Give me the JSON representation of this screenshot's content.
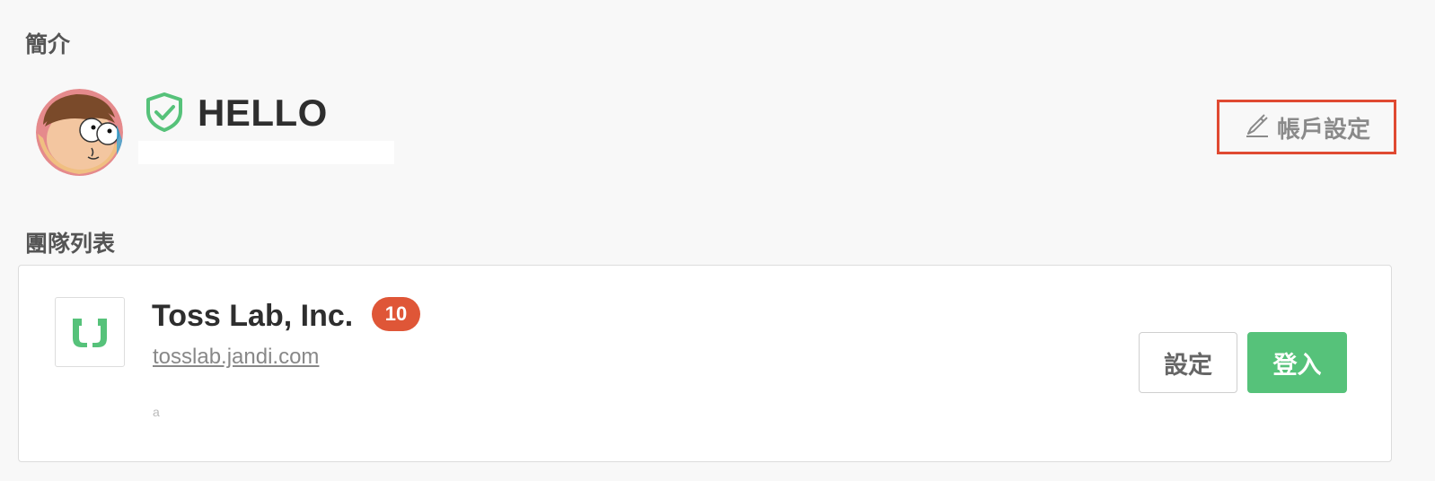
{
  "profile": {
    "section_label": "簡介",
    "user_name": "HELLO",
    "status_message": "",
    "verified_icon": "shield-check-icon",
    "account_settings_label": "帳戶設定",
    "account_settings_icon": "edit-pen-icon",
    "highlight_color": "#e04a32"
  },
  "teams": {
    "section_label": "團隊列表",
    "items": [
      {
        "name": "Toss Lab, Inc.",
        "badge_count": "10",
        "url": "tosslab.jandi.com",
        "extra_text": "a",
        "logo_icon": "jandi-logo-icon",
        "settings_label": "設定",
        "login_label": "登入"
      }
    ]
  },
  "colors": {
    "accent_green": "#56c27a",
    "badge_red": "#df5637"
  }
}
